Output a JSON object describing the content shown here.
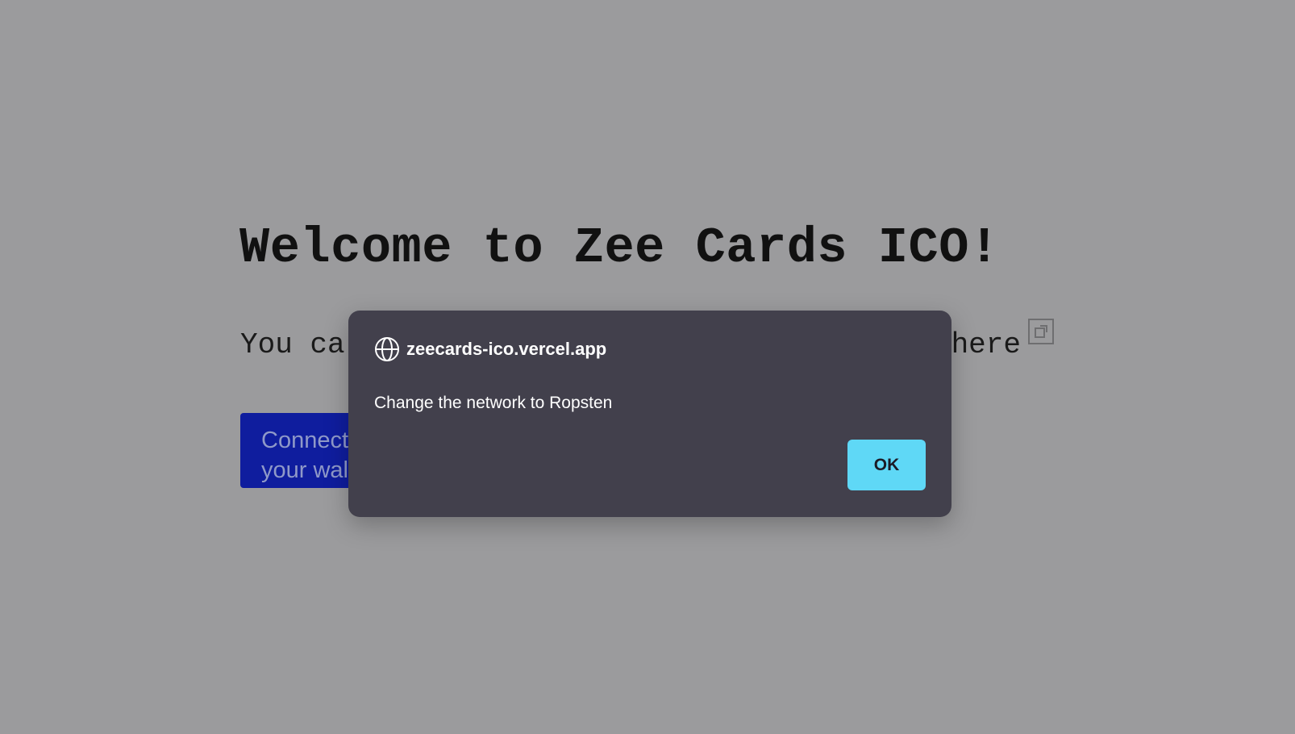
{
  "page": {
    "heading": "Welcome to Zee Cards ICO!",
    "subtext_visible_start": "You ca",
    "subtext_visible_end": "here",
    "connect_button_label": "Connect your wallet"
  },
  "dialog": {
    "origin": "zeecards-ico.vercel.app",
    "message": "Change the network to Ropsten",
    "ok_label": "OK"
  },
  "icons": {
    "globe": "globe-icon",
    "external_link": "external-link-icon"
  },
  "colors": {
    "backdrop": "#9b9b9d",
    "dialog_background": "#42404c",
    "ok_button": "#5fd8f6",
    "connect_button": "#0f1d9e"
  }
}
